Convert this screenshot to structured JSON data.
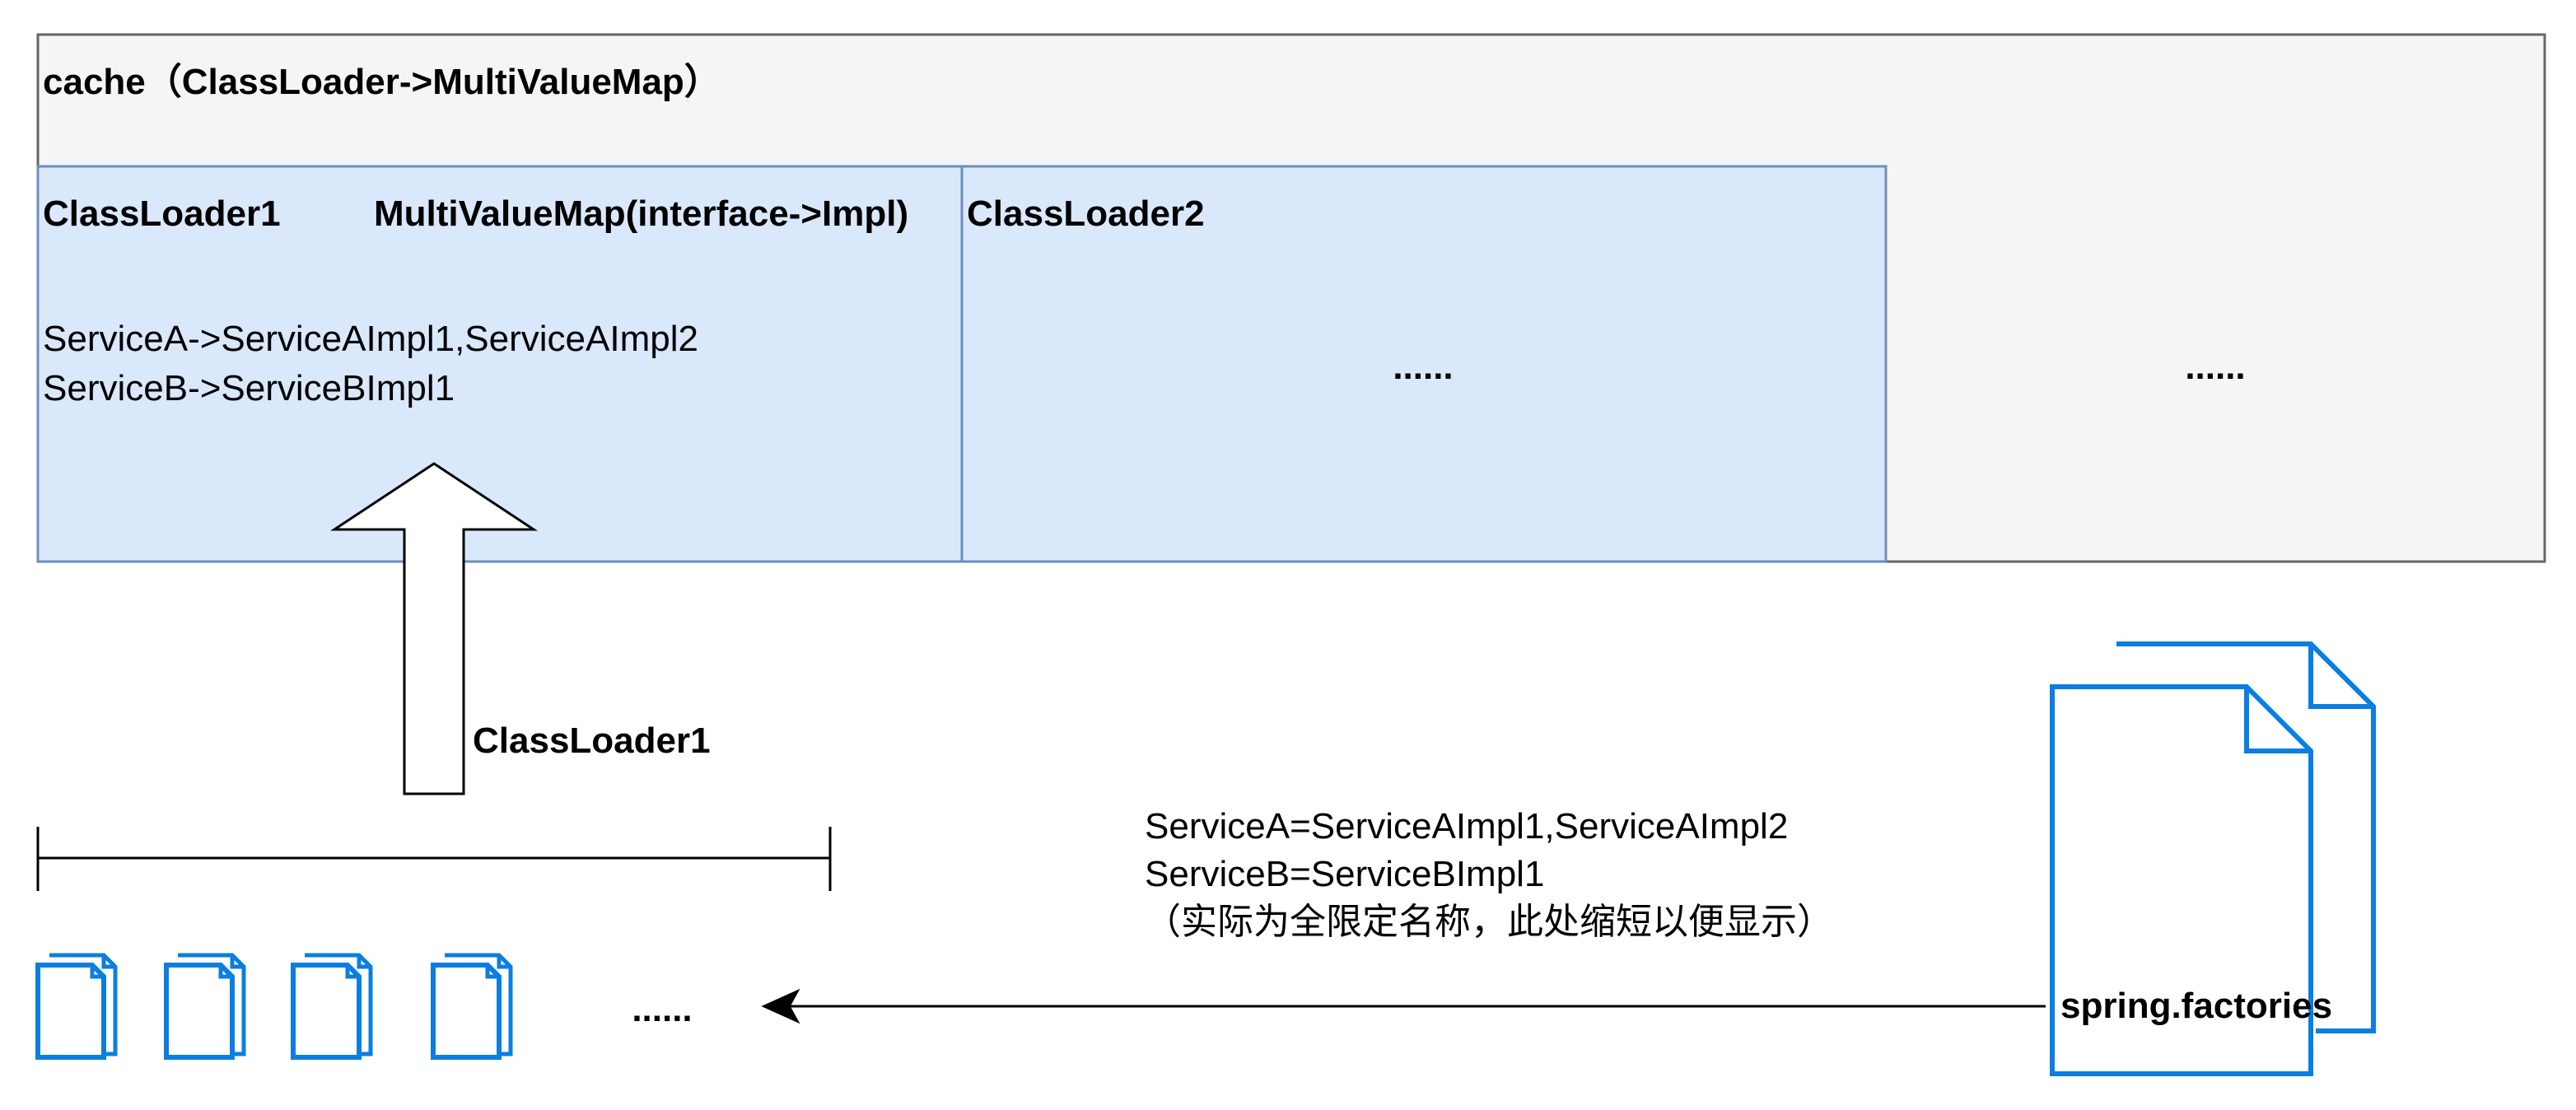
{
  "cache": {
    "title": "cache（ClassLoader->MultiValueMap）",
    "ellipsis": "......"
  },
  "classloader1_box": {
    "title": "ClassLoader1",
    "map_title": "MultiValueMap(interface->Impl)",
    "line1": "ServiceA->ServiceAImpl1,ServiceAImpl2",
    "line2": "ServiceB->ServiceBImpl1"
  },
  "classloader2_box": {
    "title": "ClassLoader2",
    "ellipsis": "......"
  },
  "arrow_label": "ClassLoader1",
  "files_ellipsis": "......",
  "factories": {
    "name": "spring.factories",
    "line1": "ServiceA=ServiceAImpl1,ServiceAImpl2",
    "line2": "ServiceB=ServiceBImpl1",
    "note": "（实际为全限定名称，此处缩短以便显示）"
  },
  "colors": {
    "cache_fill": "#f5f5f5",
    "cache_stroke": "#666666",
    "box_fill": "#dae8fc",
    "box_stroke": "#6c8ebf",
    "doc_blue": "#0b7ee1"
  }
}
